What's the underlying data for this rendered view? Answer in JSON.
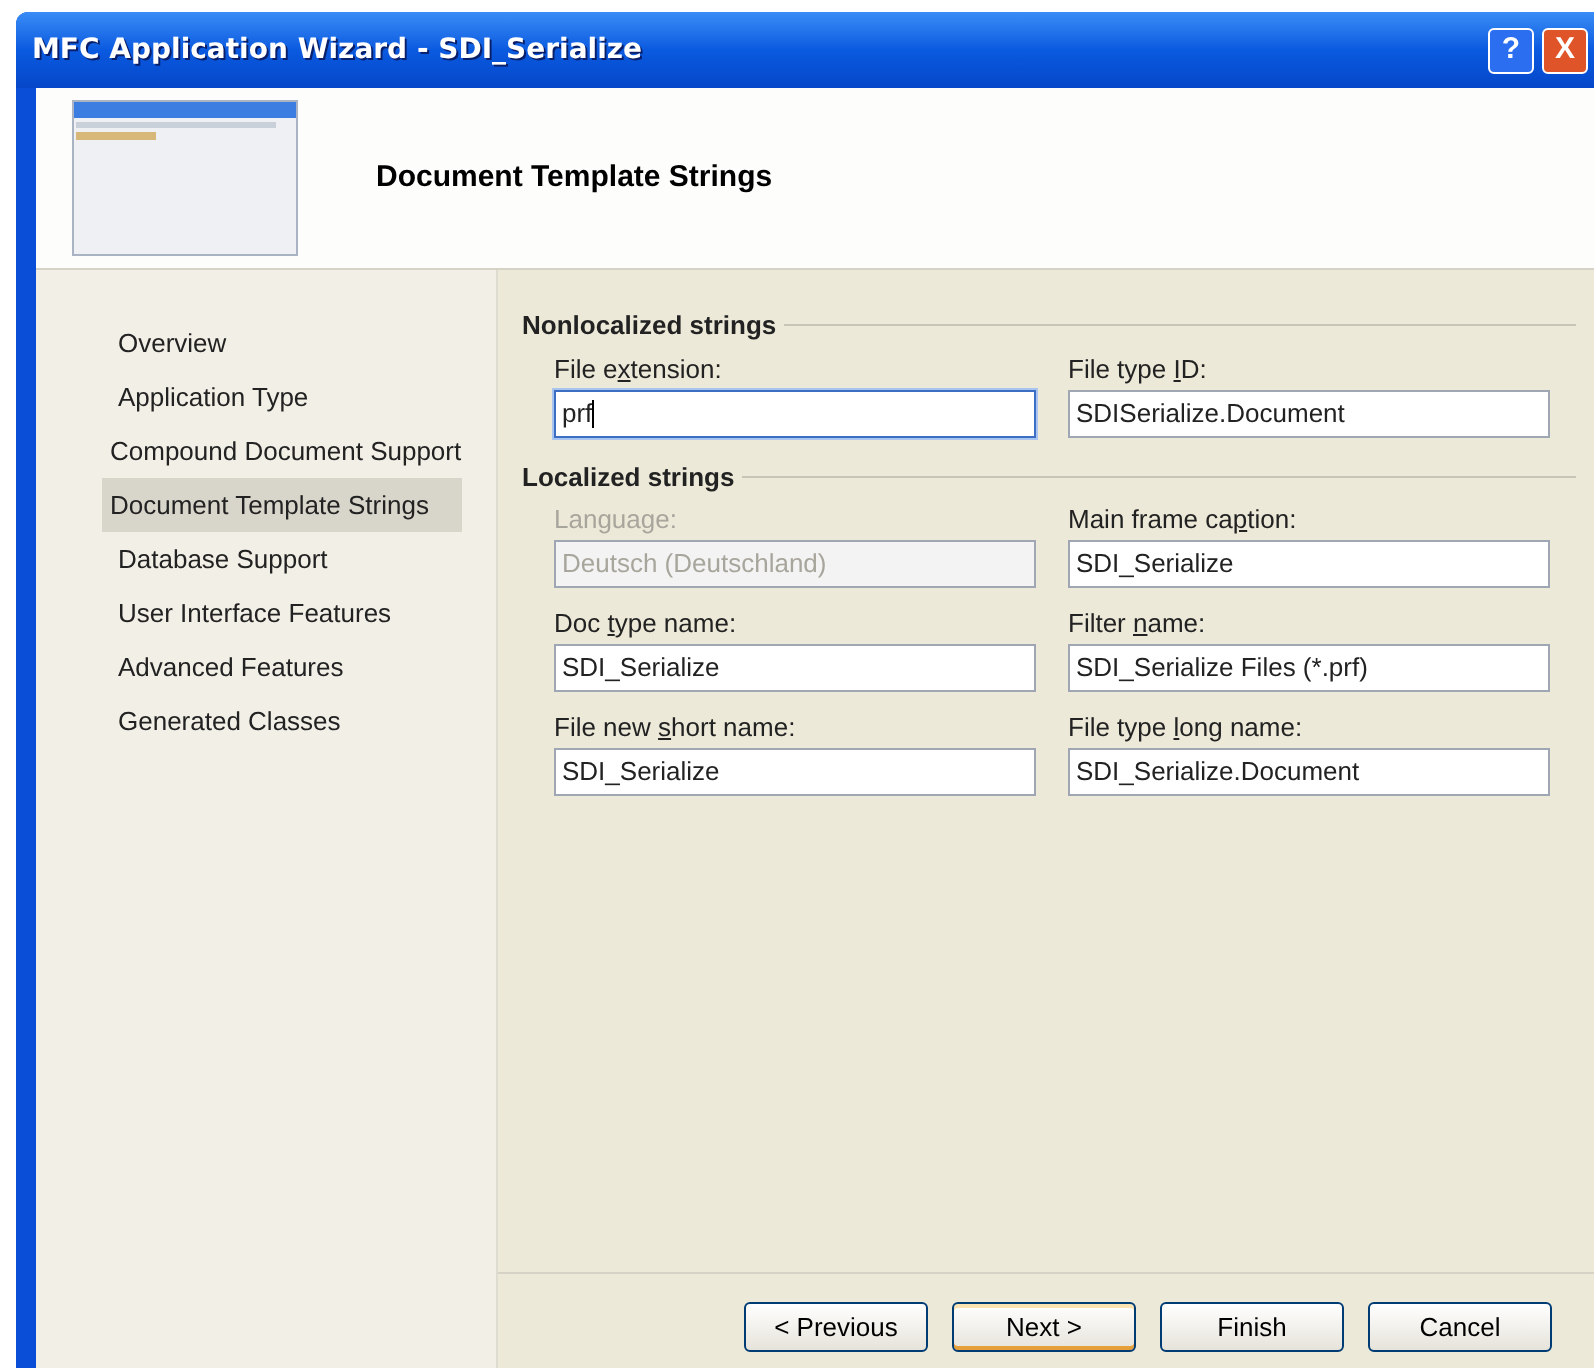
{
  "window": {
    "title": "MFC Application Wizard - SDI_Serialize",
    "title_buttons": [
      "?",
      "X"
    ]
  },
  "header": {
    "title": "Document Template Strings"
  },
  "sidebar": {
    "items": [
      {
        "label": "Overview",
        "selected": false
      },
      {
        "label": "Application Type",
        "selected": false,
        "children": [
          {
            "label": "Compound Document Support",
            "selected": false
          },
          {
            "label": "Document Template Strings",
            "selected": true
          }
        ]
      },
      {
        "label": "Database Support",
        "selected": false
      },
      {
        "label": "User Interface Features",
        "selected": false
      },
      {
        "label": "Advanced Features",
        "selected": false
      },
      {
        "label": "Generated Classes",
        "selected": false
      }
    ]
  },
  "groups": [
    {
      "title": "Nonlocalized strings",
      "fields": [
        {
          "label_before": "File e",
          "access_key": "x",
          "label_after": "tension:",
          "value": "prf",
          "disabled": false,
          "focused": true
        },
        {
          "label_before": "File type ",
          "access_key": "I",
          "label_after": "D:",
          "value": "SDISerialize.Document",
          "disabled": false,
          "focused": false
        }
      ]
    },
    {
      "title": "Localized strings",
      "fields": [
        {
          "label_before": "Language:",
          "value": "Deutsch (Deutschland)",
          "disabled": true,
          "focused": false
        },
        {
          "label_before": "Main frame ca",
          "access_key": "p",
          "label_after": "tion:",
          "value": "SDI_Serialize",
          "disabled": false,
          "focused": false
        },
        {
          "label_before": "Doc ",
          "access_key": "t",
          "label_after": "ype name:",
          "value": "SDI_Serialize",
          "disabled": false,
          "focused": false
        },
        {
          "label_before": "Filter ",
          "access_key": "n",
          "label_after": "ame:",
          "value": "SDI_Serialize Files (*.prf)",
          "disabled": false,
          "focused": false
        },
        {
          "label_before": "File new ",
          "access_key": "s",
          "label_after": "hort name:",
          "value": "SDI_Serialize",
          "disabled": false,
          "focused": false
        },
        {
          "label_before": "File type ",
          "access_key": "l",
          "label_after": "ong name:",
          "value": "SDI_Serialize.Document",
          "disabled": false,
          "focused": false
        }
      ]
    }
  ],
  "buttons": [
    {
      "label": "< Previous",
      "default": false
    },
    {
      "label": "Next >",
      "default": true
    },
    {
      "label": "Finish",
      "default": false
    },
    {
      "label": "Cancel",
      "default": false
    }
  ]
}
